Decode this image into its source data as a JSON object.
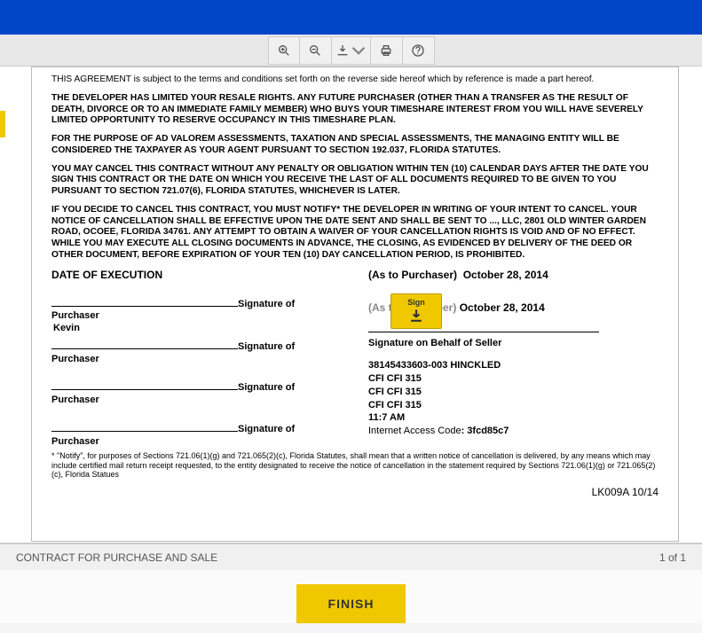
{
  "document": {
    "p0": "THIS AGREEMENT is subject to the terms and conditions set forth on the reverse side hereof which by reference is made a part hereof.",
    "p1": "THE DEVELOPER HAS LIMITED YOUR RESALE RIGHTS. ANY FUTURE PURCHASER (OTHER THAN A TRANSFER AS THE RESULT OF DEATH, DIVORCE OR TO AN IMMEDIATE FAMILY MEMBER) WHO BUYS YOUR TIMESHARE INTEREST FROM YOU WILL HAVE SEVERELY LIMITED OPPORTUNITY TO RESERVE OCCUPANCY IN THIS TIMESHARE PLAN.",
    "p2": "FOR THE PURPOSE OF AD VALOREM ASSESSMENTS, TAXATION AND SPECIAL ASSESSMENTS, THE MANAGING ENTITY WILL BE CONSIDERED THE TAXPAYER AS YOUR AGENT PURSUANT TO SECTION 192.037, FLORIDA STATUTES.",
    "p3": "YOU MAY CANCEL THIS CONTRACT WITHOUT ANY PENALTY OR OBLIGATION WITHIN TEN (10) CALENDAR DAYS AFTER THE DATE YOU SIGN THIS CONTRACT OR THE DATE ON WHICH YOU RECEIVE THE LAST OF ALL DOCUMENTS REQUIRED TO BE GIVEN TO YOU PURSUANT TO SECTION 721.07(6), FLORIDA STATUTES, WHICHEVER IS LATER.",
    "p4": "IF YOU DECIDE TO CANCEL THIS CONTRACT, YOU MUST NOTIFY* THE DEVELOPER IN WRITING OF YOUR INTENT TO CANCEL. YOUR NOTICE OF CANCELLATION SHALL BE EFFECTIVE UPON THE DATE SENT AND SHALL BE SENT TO ..., LLC, 2801 OLD WINTER GARDEN ROAD, OCOEE, FLORIDA 34761. ANY ATTEMPT TO OBTAIN A WAIVER OF YOUR CANCELLATION RIGHTS IS VOID AND OF NO EFFECT. WHILE YOU MAY EXECUTE ALL CLOSING DOCUMENTS IN ADVANCE, THE CLOSING, AS EVIDENCED BY DELIVERY OF THE DEED OR OTHER DOCUMENT, BEFORE EXPIRATION OF YOUR TEN (10) DAY CANCELLATION PERIOD, IS PROHIBITED.",
    "exec_label": "DATE OF EXECUTION",
    "sig_label": "Signature of Purchaser",
    "purchaser_name": "Kevin",
    "as_purchaser": "(As to Purchaser)",
    "purchaser_date": "October 28, 2014",
    "as_developer": "(As to Developer)",
    "developer_date": "October 28, 2014",
    "seller_sig_label": "Signature on Behalf of Seller",
    "ref_line": "38145433603-003 HINCKLED",
    "cfi1": "CFI  CFI 315",
    "cfi2": "CFI  CFI 315",
    "cfi3": "CFI  CFI 315",
    "time": "11:7 AM",
    "access_label": "Internet Access Code",
    "access_sep": ": ",
    "access_code": "3fcd85c7",
    "footnote": "* \"Notify\", for purposes of Sections 721.06(1)(g) and 721.065(2)(c), Florida Statutes, shall mean that a written notice of cancellation is delivered, by any means which may include certified mail return receipt requested, to the entity designated to receive the notice of cancellation in the statement required by Sections 721.06(1)(g) or 721.065(2)(c), Florida Statues",
    "form_code": "LK009A 10/14"
  },
  "sign_callout": {
    "label": "Sign"
  },
  "status": {
    "title": "CONTRACT FOR PURCHASE AND SALE",
    "page": "1 of 1"
  },
  "finish": {
    "label": "FINISH"
  }
}
